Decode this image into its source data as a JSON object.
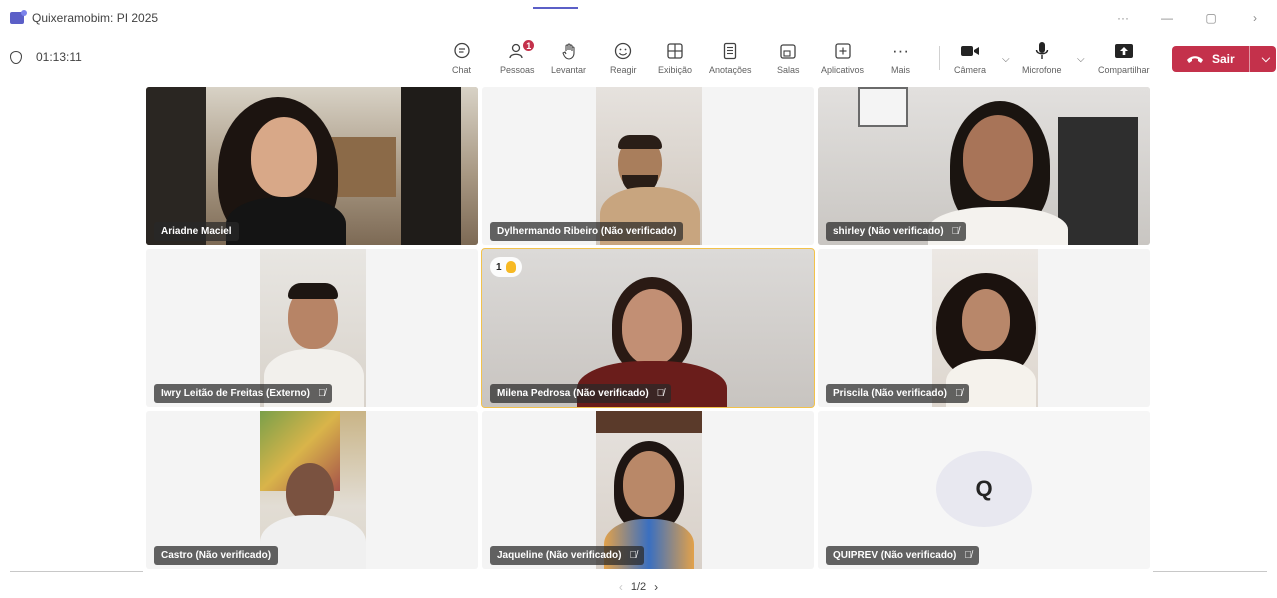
{
  "window": {
    "title": "Quixeramobim: PI 2025",
    "controls": [
      "···",
      "—",
      "▢",
      "›"
    ]
  },
  "meeting": {
    "timer": "01:13:11"
  },
  "toolbar": {
    "items": [
      {
        "label": "Chat",
        "icon": "chat-icon",
        "glyph": "☺"
      },
      {
        "label": "Pessoas",
        "icon": "people-icon",
        "glyph": "⚇",
        "badge": "1"
      },
      {
        "label": "Levantar",
        "icon": "raise-hand-icon",
        "glyph": "✋"
      },
      {
        "label": "Reagir",
        "icon": "react-icon",
        "glyph": "☺"
      },
      {
        "label": "Exibição",
        "icon": "view-icon",
        "glyph": "⊞"
      },
      {
        "label": "Anotações",
        "icon": "notes-icon",
        "glyph": "▤"
      },
      {
        "label": "Salas",
        "icon": "rooms-icon",
        "glyph": "⧉"
      },
      {
        "label": "Aplicativos",
        "icon": "apps-icon",
        "glyph": "⊞"
      },
      {
        "label": "Mais",
        "icon": "more-icon",
        "glyph": "···"
      },
      {
        "label": "Câmera",
        "icon": "camera-icon",
        "glyph": "■"
      },
      {
        "label": "Microfone",
        "icon": "microphone-icon",
        "glyph": "🎤"
      },
      {
        "label": "Compartilhar",
        "icon": "share-icon",
        "glyph": "⬆"
      }
    ],
    "leave_label": "Sair",
    "leave_color": "#c4314b"
  },
  "participants": [
    {
      "name": "Ariadne Maciel",
      "muted": false
    },
    {
      "name": "Dylhermando Ribeiro (Não verificado)",
      "muted": false
    },
    {
      "name": "shirley (Não verificado)",
      "muted": true
    },
    {
      "name": "Iwry Leitão de Freitas (Externo)",
      "muted": true
    },
    {
      "name": "Milena Pedrosa (Não verificado)",
      "muted": true,
      "active": true,
      "hand_raised": "1"
    },
    {
      "name": "Priscila (Não verificado)",
      "muted": true
    },
    {
      "name": "Castro (Não verificado)",
      "muted": false
    },
    {
      "name": "Jaqueline (Não verificado)",
      "muted": true
    },
    {
      "name": "QUIPREV (Não verificado)",
      "muted": true,
      "avatar_initial": "Q"
    }
  ],
  "pager": {
    "label": "1/2"
  },
  "colors": {
    "accent": "#5b5fc7",
    "active_speaker": "#f2c24b"
  }
}
